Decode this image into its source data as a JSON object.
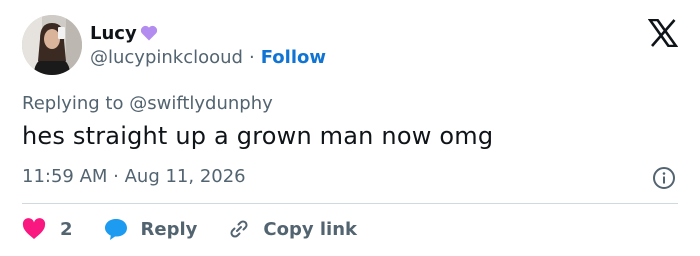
{
  "author": {
    "display_name": "Lucy",
    "name_emoji": "purple-heart-icon",
    "handle": "@lucypinkclooud",
    "separator": "·",
    "follow_label": "Follow"
  },
  "reply_context": {
    "prefix": "Replying to",
    "mention": "@swiftlydunphy"
  },
  "tweet": {
    "text": "hes straight up a grown man now omg",
    "timestamp": "11:59 AM · Aug 11, 2026"
  },
  "actions": {
    "like_count": "2",
    "reply_label": "Reply",
    "copy_link_label": "Copy link"
  },
  "icons": {
    "brand": "x-logo-icon",
    "info": "info-icon",
    "like": "heart-icon",
    "reply": "speech-bubble-icon",
    "copy": "link-icon"
  },
  "colors": {
    "text_primary": "#0f1419",
    "text_secondary": "#536471",
    "link_blue": "#0f74d4",
    "like_pink": "#f91880",
    "reply_blue": "#1d9bf0",
    "emoji_purple": "#b38cf0",
    "divider": "#cfd9de"
  }
}
